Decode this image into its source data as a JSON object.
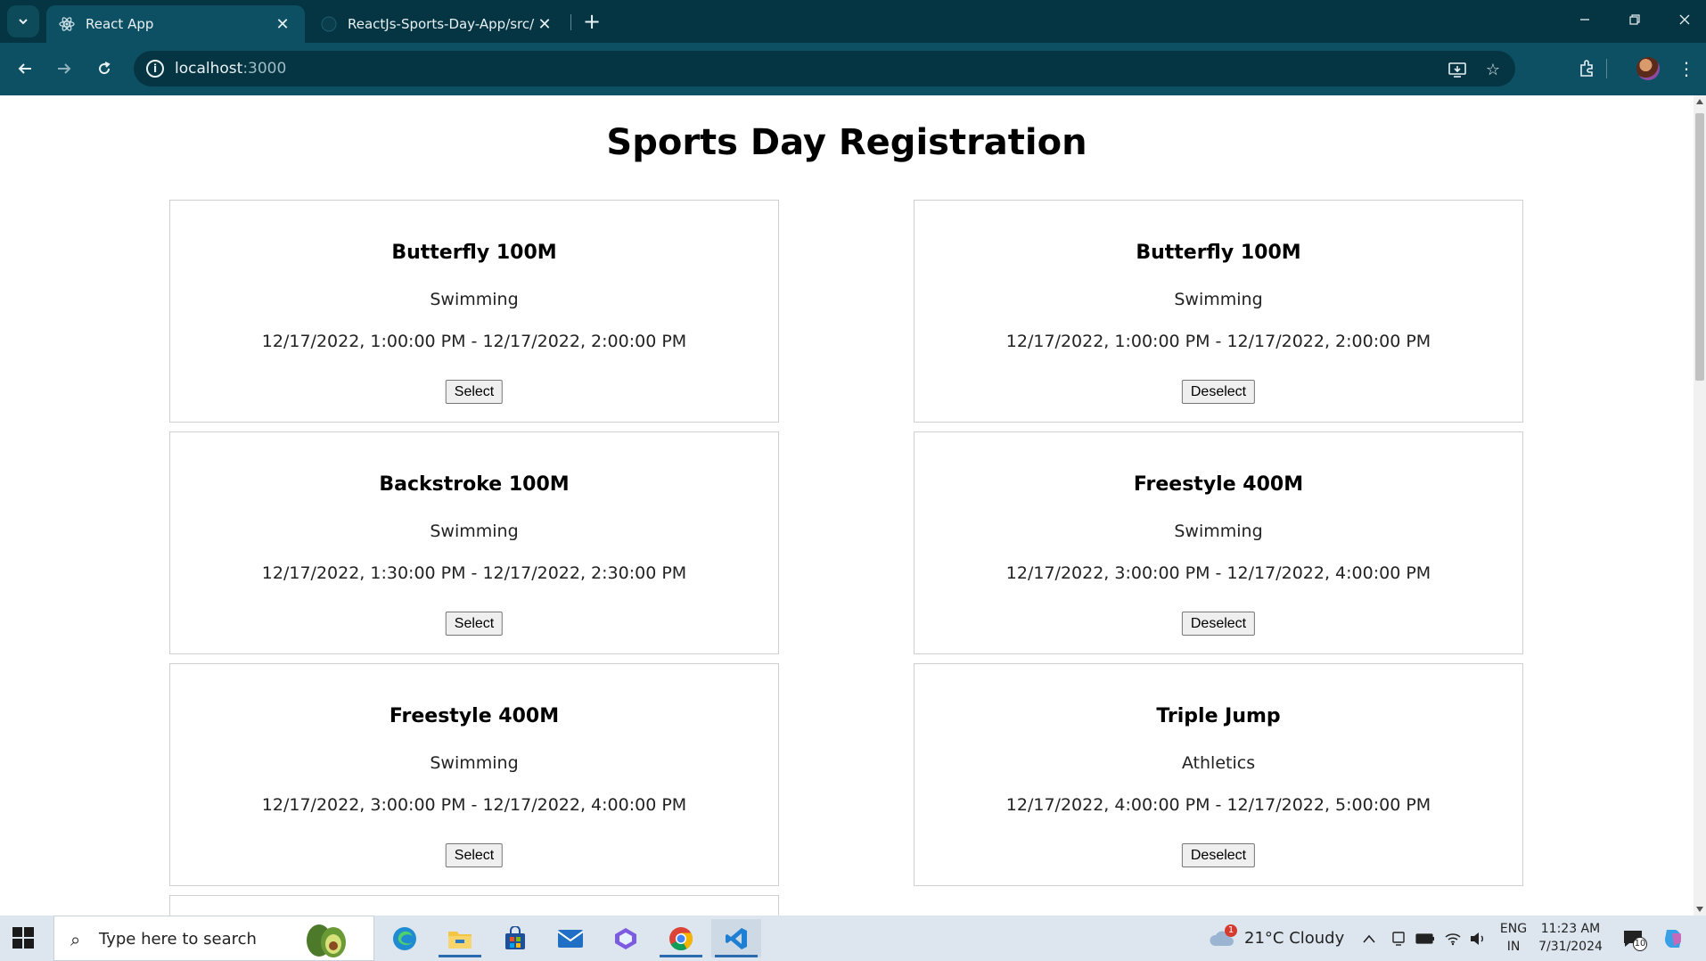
{
  "browser": {
    "tabs": [
      {
        "title": "React App",
        "active": true
      },
      {
        "title": "ReactJs-Sports-Day-App/src/da",
        "active": false
      }
    ],
    "url_host": "localhost",
    "url_port": ":3000"
  },
  "page": {
    "title": "Sports Day Registration",
    "events": [
      {
        "name": "Butterfly 100M",
        "category": "Swimming",
        "time": "12/17/2022, 1:00:00 PM - 12/17/2022, 2:00:00 PM",
        "button": "Select"
      },
      {
        "name": "Butterfly 100M",
        "category": "Swimming",
        "time": "12/17/2022, 1:00:00 PM - 12/17/2022, 2:00:00 PM",
        "button": "Deselect"
      },
      {
        "name": "Backstroke 100M",
        "category": "Swimming",
        "time": "12/17/2022, 1:30:00 PM - 12/17/2022, 2:30:00 PM",
        "button": "Select"
      },
      {
        "name": "Freestyle 400M",
        "category": "Swimming",
        "time": "12/17/2022, 3:00:00 PM - 12/17/2022, 4:00:00 PM",
        "button": "Deselect"
      },
      {
        "name": "Freestyle 400M",
        "category": "Swimming",
        "time": "12/17/2022, 3:00:00 PM - 12/17/2022, 4:00:00 PM",
        "button": "Select"
      },
      {
        "name": "Triple Jump",
        "category": "Athletics",
        "time": "12/17/2022, 4:00:00 PM - 12/17/2022, 5:00:00 PM",
        "button": "Deselect"
      }
    ]
  },
  "taskbar": {
    "search_placeholder": "Type here to search",
    "weather": "21°C  Cloudy",
    "weather_alert": "1",
    "lang": "ENG",
    "region": "IN",
    "time": "11:23 AM",
    "date": "7/31/2024",
    "notification_count": "10"
  },
  "colors": {
    "tabbar": "#053543",
    "toolbar": "#0e5063",
    "taskbar": "#dde6ef"
  }
}
